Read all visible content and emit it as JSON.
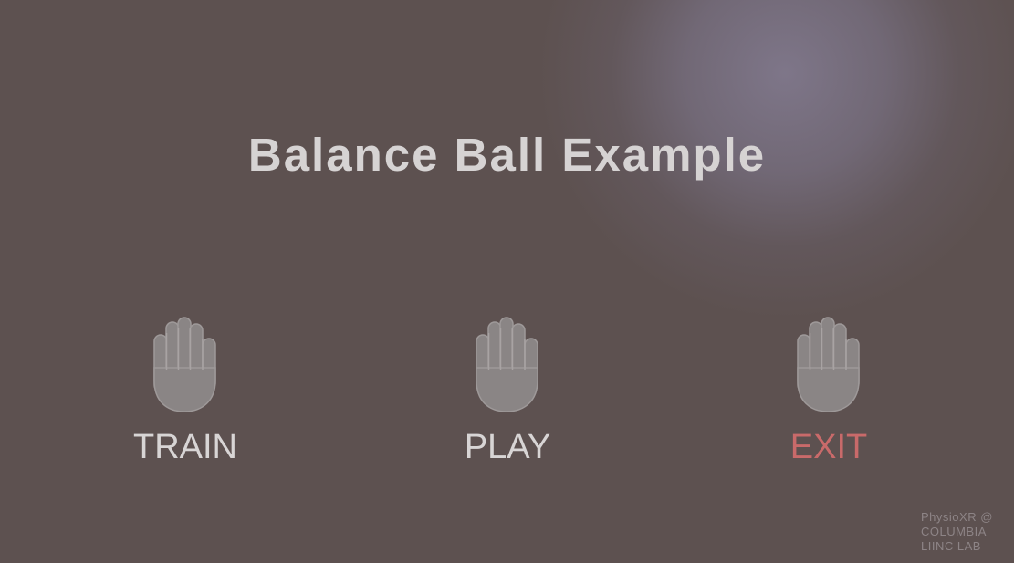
{
  "title": "Balance Ball Example",
  "menu": {
    "train": {
      "label": "TRAIN",
      "icon": "hand-icon"
    },
    "play": {
      "label": "PLAY",
      "icon": "hand-icon"
    },
    "exit": {
      "label": "EXIT",
      "icon": "hand-icon"
    }
  },
  "credit": {
    "line1": "PhysioXR @",
    "line2": "COLUMBIA",
    "line3": "LIINC LAB"
  },
  "colors": {
    "background": "#5d5150",
    "text": "#d8d5d5",
    "exit_accent": "#c96a6a",
    "hand_fill": "#8a8585"
  }
}
